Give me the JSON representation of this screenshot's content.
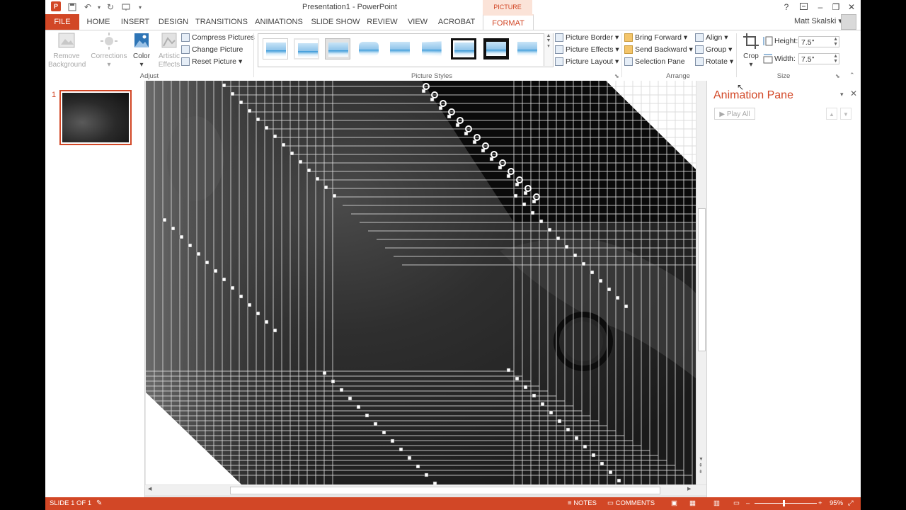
{
  "window": {
    "doc_title": "Presentation1 - PowerPoint",
    "user_name": "Matt Skalski",
    "help_label": "?"
  },
  "tabs": [
    {
      "label": "FILE"
    },
    {
      "label": "HOME"
    },
    {
      "label": "INSERT"
    },
    {
      "label": "DESIGN"
    },
    {
      "label": "TRANSITIONS"
    },
    {
      "label": "ANIMATIONS"
    },
    {
      "label": "SLIDE SHOW"
    },
    {
      "label": "REVIEW"
    },
    {
      "label": "VIEW"
    },
    {
      "label": "ACROBAT"
    },
    {
      "label": "FORMAT"
    }
  ],
  "contextual_header": "PICTURE TOOLS",
  "ribbon": {
    "adjust": {
      "group_label": "Adjust",
      "remove_background": "Remove\nBackground",
      "remove_background_line1": "Remove",
      "remove_background_line2": "Background",
      "corrections": "Corrections",
      "color": "Color",
      "artistic_effects_line1": "Artistic",
      "artistic_effects_line2": "Effects",
      "compress_pictures": "Compress Pictures",
      "change_picture": "Change Picture",
      "reset_picture": "Reset Picture"
    },
    "picture_styles": {
      "group_label": "Picture Styles",
      "picture_border": "Picture Border",
      "picture_effects": "Picture Effects",
      "picture_layout": "Picture Layout"
    },
    "arrange": {
      "group_label": "Arrange",
      "bring_forward": "Bring Forward",
      "send_backward": "Send Backward",
      "selection_pane": "Selection Pane",
      "align": "Align",
      "group": "Group",
      "rotate": "Rotate"
    },
    "size": {
      "group_label": "Size",
      "crop": "Crop",
      "height_label": "Height:",
      "height_value": "7.5\"",
      "width_label": "Width:",
      "width_value": "7.5\""
    }
  },
  "thumbnails": {
    "slide_number": "1"
  },
  "animation_pane": {
    "title": "Animation Pane",
    "play_all": "Play All"
  },
  "statusbar": {
    "slide_indicator": "SLIDE 1 OF 1",
    "notes": "NOTES",
    "comments": "COMMENTS",
    "zoom": "95%"
  },
  "colors": {
    "accent": "#d24726",
    "picture_tools_bg": "#fbe3d8"
  }
}
